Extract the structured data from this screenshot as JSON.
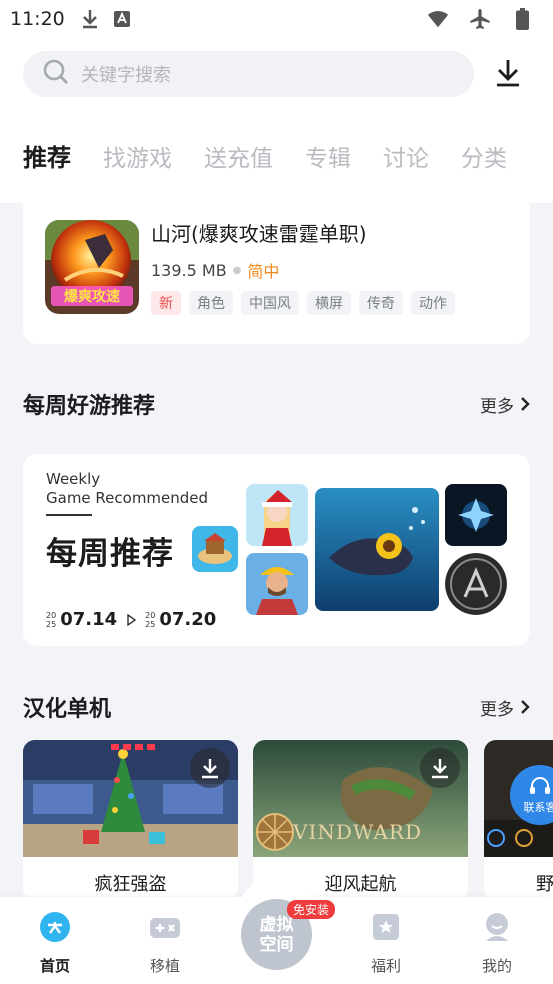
{
  "status_bar": {
    "time": "11:20"
  },
  "search": {
    "placeholder": "关键字搜索"
  },
  "tabs": [
    {
      "label": "推荐",
      "active": true
    },
    {
      "label": "找游戏"
    },
    {
      "label": "送充值"
    },
    {
      "label": "专辑"
    },
    {
      "label": "讨论"
    },
    {
      "label": "分类"
    }
  ],
  "featured_game": {
    "title": "山河(爆爽攻速雷霆单职)",
    "size": "139.5 MB",
    "language": "简中",
    "thumb_text": "爆爽攻速",
    "tags": [
      "新",
      "角色",
      "中国风",
      "横屏",
      "传奇",
      "动作"
    ]
  },
  "weekly_section": {
    "title": "每周好游推荐",
    "more": "更多",
    "banner": {
      "en_line1": "Weekly",
      "en_line2": "Game Recommended",
      "cn_title": "每周推荐",
      "start_year_top": "20",
      "start_year_bottom": "25",
      "start_date": "07.14",
      "end_year_top": "20",
      "end_year_bottom": "25",
      "end_date": "07.20"
    }
  },
  "hanhua_section": {
    "title": "汉化单机",
    "more": "更多",
    "games": [
      {
        "name": "疯狂强盗"
      },
      {
        "name": "迎风起航",
        "logo_text": "VINDWARD"
      },
      {
        "name": "野"
      }
    ]
  },
  "contact": {
    "label": "联系客"
  },
  "bottom_nav": {
    "home": "首页",
    "port": "移植",
    "virtual_space_line1": "虚拟",
    "virtual_space_line2": "空间",
    "virtual_badge": "免安装",
    "welfare": "福利",
    "mine": "我的"
  },
  "colors": {
    "accent_orange": "#f08a16",
    "tag_new_red": "#ea4b4b",
    "home_icon_blue": "#2fb4ef",
    "badge_red": "#ee3b3b"
  }
}
